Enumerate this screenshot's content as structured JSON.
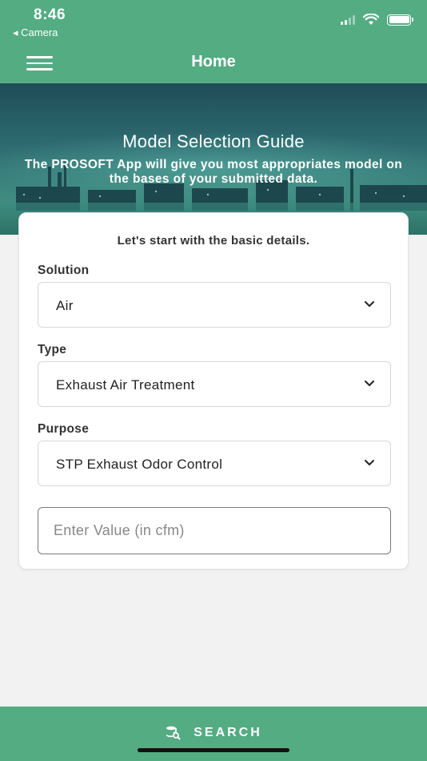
{
  "status_bar": {
    "time": "8:46",
    "back_label": "◂ Camera",
    "icons": [
      "cellular-signal-icon",
      "wifi-icon",
      "battery-icon"
    ]
  },
  "header": {
    "title": "Home",
    "menu_icon": "hamburger-menu-icon"
  },
  "hero": {
    "title": "Model Selection Guide",
    "subtitle": "The PROSOFT App will give you most appropriates model on the bases of your submitted data."
  },
  "form": {
    "intro": "Let's start with the basic details.",
    "solution": {
      "label": "Solution",
      "value": "Air"
    },
    "type": {
      "label": "Type",
      "value": "Exhaust Air Treatment"
    },
    "purpose": {
      "label": "Purpose",
      "value": "STP Exhaust Odor Control"
    },
    "value_input": {
      "placeholder": "Enter Value (in cfm)",
      "value": ""
    }
  },
  "footer": {
    "search_label": "SEARCH",
    "search_icon": "database-search-icon"
  },
  "colors": {
    "brand_green": "#53ac82",
    "text_dark": "#333333",
    "background": "#f2f2f2"
  }
}
